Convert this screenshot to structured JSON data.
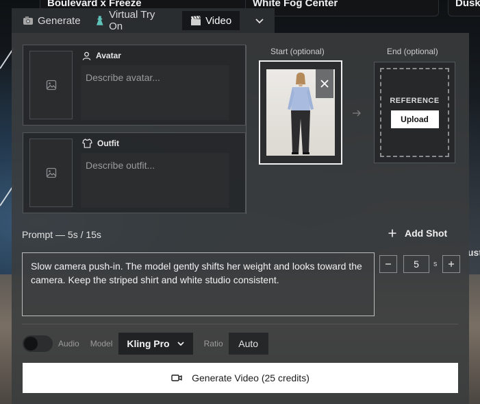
{
  "background": {
    "cards": [
      "Boulevard x Freeze",
      "White Fog Center",
      "Dusk"
    ],
    "edge_text": "ust"
  },
  "tabs": [
    {
      "label": "Generate",
      "icon": "camera-icon",
      "active": false
    },
    {
      "label": "Virtual Try On",
      "icon": "dress-icon",
      "active": false
    },
    {
      "label": "Video",
      "icon": "clapperboard-icon",
      "active": true
    }
  ],
  "avatar": {
    "label": "Avatar",
    "placeholder": "Describe avatar..."
  },
  "outfit": {
    "label": "Outfit",
    "placeholder": "Describe outfit..."
  },
  "frames": {
    "start_label": "Start (optional)",
    "end_label": "End (optional)",
    "end_reference": "REFERENCE",
    "upload_label": "Upload"
  },
  "prompt": {
    "title": "Prompt — 5s / 15s",
    "add_shot": "Add Shot",
    "text": "Slow camera push-in. The model gently shifts her weight and looks toward the camera. Keep the striped shirt and white studio consistent."
  },
  "duration": {
    "value": "5",
    "unit": "s"
  },
  "controls": {
    "audio_label": "Audio",
    "audio_on": false,
    "model_label": "Model",
    "model_value": "Kling Pro",
    "ratio_label": "Ratio",
    "ratio_value": "Auto"
  },
  "generate_label": "Generate Video (25 credits)",
  "colors": {
    "panel": "#3a3c3e",
    "button": "#ffffff",
    "accent_text": "#f0f0f0"
  }
}
